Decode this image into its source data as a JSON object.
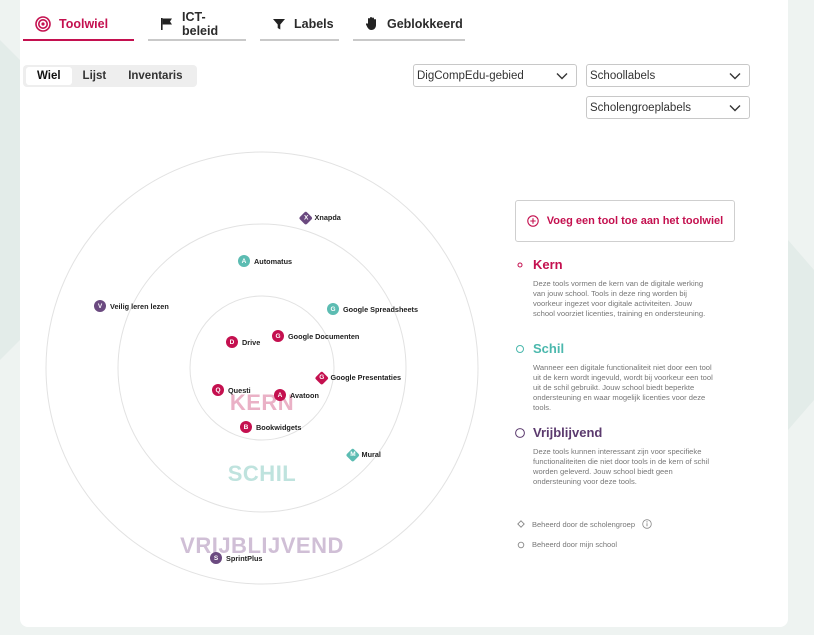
{
  "tabs": [
    {
      "label": "Toolwiel",
      "icon": "target-icon",
      "active": true
    },
    {
      "label": "ICT-beleid",
      "icon": "flag-icon",
      "active": false
    },
    {
      "label": "Labels",
      "icon": "filter-icon",
      "active": false
    },
    {
      "label": "Geblokkeerd",
      "icon": "hand-icon",
      "active": false
    }
  ],
  "view_toggle": {
    "items": [
      "Wiel",
      "Lijst",
      "Inventaris"
    ],
    "selected": "Wiel"
  },
  "filters": {
    "digcomp": "DigCompEdu-gebied",
    "school_labels": "Schoollabels",
    "group_labels": "Scholengroeplabels"
  },
  "wheel": {
    "rings": {
      "kern": "KERN",
      "schil": "SCHIL",
      "vrijblijvend": "VRIJBLIJVEND"
    },
    "tools": [
      {
        "name": "Xnapda",
        "letter": "X",
        "ring": "vrijblijvend",
        "scope": "group"
      },
      {
        "name": "Automatus",
        "letter": "A",
        "ring": "schil",
        "scope": "school"
      },
      {
        "name": "Veilig leren lezen",
        "letter": "V",
        "ring": "vrijblijvend",
        "scope": "school"
      },
      {
        "name": "Google Spreadsheets",
        "letter": "G",
        "ring": "schil",
        "scope": "school"
      },
      {
        "name": "Drive",
        "letter": "D",
        "ring": "kern",
        "scope": "school"
      },
      {
        "name": "Google Documenten",
        "letter": "G",
        "ring": "kern",
        "scope": "school"
      },
      {
        "name": "Google Presentaties",
        "letter": "G",
        "ring": "kern",
        "scope": "group"
      },
      {
        "name": "Questi",
        "letter": "Q",
        "ring": "kern",
        "scope": "school"
      },
      {
        "name": "Avatoon",
        "letter": "A",
        "ring": "kern",
        "scope": "school"
      },
      {
        "name": "Bookwidgets",
        "letter": "B",
        "ring": "kern",
        "scope": "school"
      },
      {
        "name": "Mural",
        "letter": "M",
        "ring": "schil",
        "scope": "group"
      },
      {
        "name": "SprintPlus",
        "letter": "S",
        "ring": "vrijblijvend",
        "scope": "school"
      }
    ]
  },
  "panel": {
    "add_button": "Voeg een tool toe aan het toolwiel",
    "legend": [
      {
        "title": "Kern",
        "color": "#c4104f",
        "desc": "Deze tools vormen de kern van de digitale werking van jouw school. Tools in deze ring worden bij voorkeur ingezet voor digitale activiteiten. Jouw school voorziet licenties, training en ondersteuning."
      },
      {
        "title": "Schil",
        "color": "#4bb8ad",
        "desc": "Wanneer een digitale functionaliteit niet door een tool uit de kern wordt ingevuld, wordt bij voorkeur een tool uit de schil gebruikt. Jouw school biedt beperkte ondersteuning en waar mogelijk licenties voor deze tools."
      },
      {
        "title": "Vrijblijvend",
        "color": "#5b3a6e",
        "desc": "Deze tools kunnen interessant zijn voor specifieke functionaliteiten die niet door tools in de kern of schil worden geleverd. Jouw school biedt geen ondersteuning voor deze tools."
      }
    ],
    "managed_group": "Beheerd door de scholengroep",
    "managed_school": "Beheerd door mijn school"
  },
  "colors": {
    "kern": "#c4104f",
    "schil": "#5cbcb2",
    "vrijblijvend": "#6b4a80",
    "accent": "#c4104f"
  }
}
